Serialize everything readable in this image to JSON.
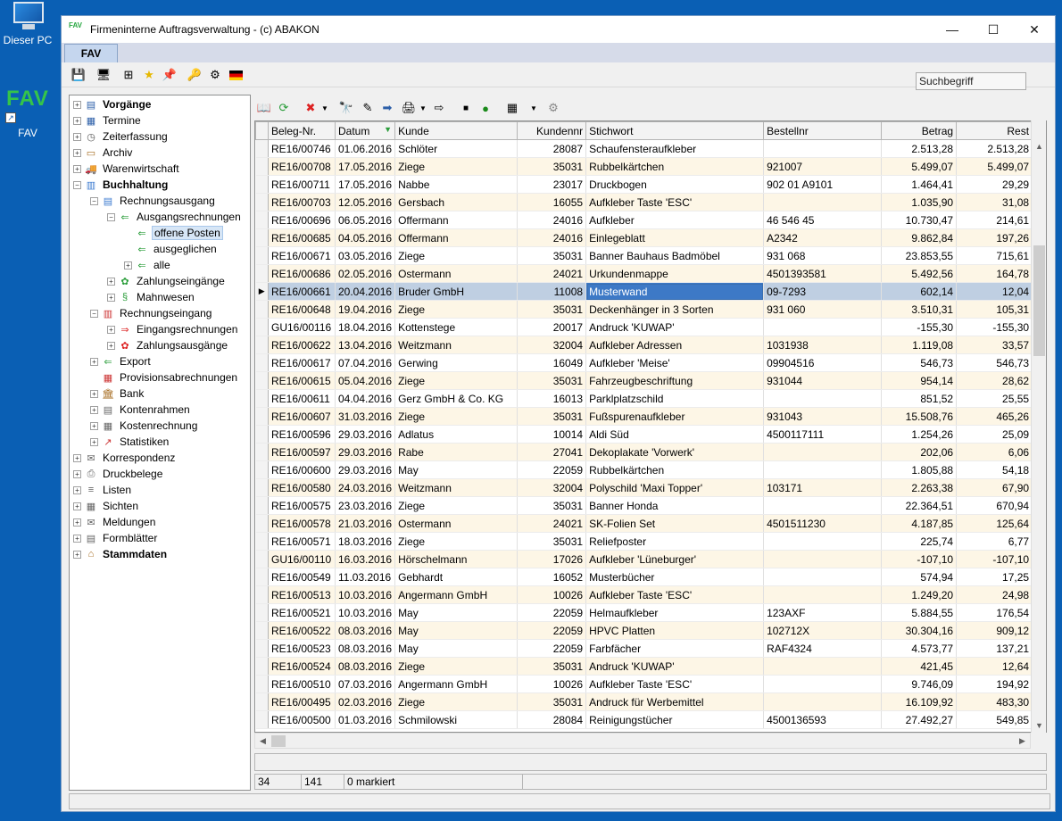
{
  "desktop": {
    "icons": [
      {
        "label": "Dieser PC",
        "icon": "computer-icon"
      },
      {
        "label": "FAV",
        "icon": "fav-app-icon",
        "logo_text": "FAV"
      }
    ]
  },
  "window": {
    "title": "Firmeninterne Auftragsverwaltung - (c) ABAKON",
    "app_logo": "FAV",
    "controls": {
      "minimize": "—",
      "maximize": "☐",
      "close": "✕"
    }
  },
  "tab": {
    "label": "FAV"
  },
  "search": {
    "value": "Suchbegriff"
  },
  "tree": [
    {
      "label": "Vorgänge",
      "level": 0,
      "expander": "+",
      "bold": true,
      "icon": "vorgaenge-icon"
    },
    {
      "label": "Termine",
      "level": 0,
      "expander": "+",
      "icon": "calendar-icon"
    },
    {
      "label": "Zeiterfassung",
      "level": 0,
      "expander": "+",
      "icon": "clock-icon"
    },
    {
      "label": "Archiv",
      "level": 0,
      "expander": "+",
      "icon": "archive-icon"
    },
    {
      "label": "Warenwirtschaft",
      "level": 0,
      "expander": "+",
      "icon": "truck-icon"
    },
    {
      "label": "Buchhaltung",
      "level": 0,
      "expander": "−",
      "bold": true,
      "icon": "bar-chart-icon"
    },
    {
      "label": "Rechnungsausgang",
      "level": 1,
      "expander": "−",
      "icon": "invoice-out-icon"
    },
    {
      "label": "Ausgangsrechnungen",
      "level": 2,
      "expander": "−",
      "icon": "arrow-left-doc-icon"
    },
    {
      "label": "offene Posten",
      "level": 3,
      "expander": "",
      "selected": true,
      "icon": "open-items-icon"
    },
    {
      "label": "ausgeglichen",
      "level": 3,
      "expander": "",
      "icon": "settled-icon"
    },
    {
      "label": "alle",
      "level": 3,
      "expander": "+",
      "icon": "all-items-icon"
    },
    {
      "label": "Zahlungseingänge",
      "level": 2,
      "expander": "+",
      "icon": "payment-in-icon"
    },
    {
      "label": "Mahnwesen",
      "level": 2,
      "expander": "+",
      "icon": "dunning-icon"
    },
    {
      "label": "Rechnungseingang",
      "level": 1,
      "expander": "−",
      "icon": "invoice-in-icon"
    },
    {
      "label": "Eingangsrechnungen",
      "level": 2,
      "expander": "+",
      "icon": "arrow-right-doc-icon"
    },
    {
      "label": "Zahlungsausgänge",
      "level": 2,
      "expander": "+",
      "icon": "payment-out-icon"
    },
    {
      "label": "Export",
      "level": 1,
      "expander": "+",
      "icon": "export-arrow-icon"
    },
    {
      "label": "Provisionsabrechnungen",
      "level": 1,
      "expander": "",
      "icon": "commission-icon"
    },
    {
      "label": "Bank",
      "level": 1,
      "expander": "+",
      "icon": "bank-icon"
    },
    {
      "label": "Kontenrahmen",
      "level": 1,
      "expander": "+",
      "icon": "accounts-icon"
    },
    {
      "label": "Kostenrechnung",
      "level": 1,
      "expander": "+",
      "icon": "calculator-icon"
    },
    {
      "label": "Statistiken",
      "level": 1,
      "expander": "+",
      "icon": "statistics-icon"
    },
    {
      "label": "Korrespondenz",
      "level": 0,
      "expander": "+",
      "icon": "letter-icon"
    },
    {
      "label": "Druckbelege",
      "level": 0,
      "expander": "+",
      "icon": "printer-icon"
    },
    {
      "label": "Listen",
      "level": 0,
      "expander": "+",
      "icon": "list-icon"
    },
    {
      "label": "Sichten",
      "level": 0,
      "expander": "+",
      "icon": "views-icon"
    },
    {
      "label": "Meldungen",
      "level": 0,
      "expander": "+",
      "icon": "envelope-icon"
    },
    {
      "label": "Formblätter",
      "level": 0,
      "expander": "+",
      "icon": "form-icon"
    },
    {
      "label": "Stammdaten",
      "level": 0,
      "expander": "+",
      "bold": true,
      "icon": "house-icon"
    }
  ],
  "grid": {
    "columns": [
      "Beleg-Nr.",
      "Datum",
      "Kunde",
      "Kundennr",
      "Stichwort",
      "Bestellnr",
      "Betrag",
      "Rest"
    ],
    "sort_indicator": "▼",
    "selected_row_marker": "▶",
    "rows": [
      [
        "RE16/00746",
        "01.06.2016",
        "Schlöter",
        "28087",
        "Schaufensteraufkleber",
        "",
        "2.513,28",
        "2.513,28"
      ],
      [
        "RE16/00708",
        "17.05.2016",
        "Ziege",
        "35031",
        "Rubbelkärtchen",
        "921007",
        "5.499,07",
        "5.499,07"
      ],
      [
        "RE16/00711",
        "17.05.2016",
        "Nabbe",
        "23017",
        "Druckbogen",
        "902 01 A9101",
        "1.464,41",
        "29,29"
      ],
      [
        "RE16/00703",
        "12.05.2016",
        "Gersbach",
        "16055",
        "Aufkleber Taste 'ESC'",
        "",
        "1.035,90",
        "31,08"
      ],
      [
        "RE16/00696",
        "06.05.2016",
        "Offermann",
        "24016",
        "Aufkleber",
        "46 546 45",
        "10.730,47",
        "214,61"
      ],
      [
        "RE16/00685",
        "04.05.2016",
        "Offermann",
        "24016",
        "Einlegeblatt",
        "A2342",
        "9.862,84",
        "197,26"
      ],
      [
        "RE16/00671",
        "03.05.2016",
        "Ziege",
        "35031",
        "Banner Bauhaus Badmöbel",
        "931 068",
        "23.853,55",
        "715,61"
      ],
      [
        "RE16/00686",
        "02.05.2016",
        "Ostermann",
        "24021",
        "Urkundenmappe",
        "4501393581",
        "5.492,56",
        "164,78"
      ],
      [
        "RE16/00661",
        "20.04.2016",
        "Bruder GmbH",
        "11008",
        "Musterwand",
        "09-7293",
        "602,14",
        "12,04"
      ],
      [
        "RE16/00648",
        "19.04.2016",
        "Ziege",
        "35031",
        "Deckenhänger in 3 Sorten",
        "931 060",
        "3.510,31",
        "105,31"
      ],
      [
        "GU16/00116",
        "18.04.2016",
        "Kottenstege",
        "20017",
        "Andruck 'KUWAP'",
        "",
        "-155,30",
        "-155,30"
      ],
      [
        "RE16/00622",
        "13.04.2016",
        "Weitzmann",
        "32004",
        "Aufkleber Adressen",
        "1031938",
        "1.119,08",
        "33,57"
      ],
      [
        "RE16/00617",
        "07.04.2016",
        "Gerwing",
        "16049",
        "Aufkleber 'Meise'",
        "09904516",
        "546,73",
        "546,73"
      ],
      [
        "RE16/00615",
        "05.04.2016",
        "Ziege",
        "35031",
        "Fahrzeugbeschriftung",
        "931044",
        "954,14",
        "28,62"
      ],
      [
        "RE16/00611",
        "04.04.2016",
        "Gerz GmbH & Co. KG",
        "16013",
        "Parklplatzschild",
        "",
        "851,52",
        "25,55"
      ],
      [
        "RE16/00607",
        "31.03.2016",
        "Ziege",
        "35031",
        "Fußspurenaufkleber",
        "931043",
        "15.508,76",
        "465,26"
      ],
      [
        "RE16/00596",
        "29.03.2016",
        "Adlatus",
        "10014",
        "Aldi Süd",
        "4500117111",
        "1.254,26",
        "25,09"
      ],
      [
        "RE16/00597",
        "29.03.2016",
        "Rabe",
        "27041",
        "Dekoplakate 'Vorwerk'",
        "",
        "202,06",
        "6,06"
      ],
      [
        "RE16/00600",
        "29.03.2016",
        "May",
        "22059",
        "Rubbelkärtchen",
        "",
        "1.805,88",
        "54,18"
      ],
      [
        "RE16/00580",
        "24.03.2016",
        "Weitzmann",
        "32004",
        "Polyschild 'Maxi Topper'",
        "103171",
        "2.263,38",
        "67,90"
      ],
      [
        "RE16/00575",
        "23.03.2016",
        "Ziege",
        "35031",
        "Banner Honda",
        "",
        "22.364,51",
        "670,94"
      ],
      [
        "RE16/00578",
        "21.03.2016",
        "Ostermann",
        "24021",
        "SK-Folien Set",
        "4501511230",
        "4.187,85",
        "125,64"
      ],
      [
        "RE16/00571",
        "18.03.2016",
        "Ziege",
        "35031",
        "Reliefposter",
        "",
        "225,74",
        "6,77"
      ],
      [
        "GU16/00110",
        "16.03.2016",
        "Hörschelmann",
        "17026",
        "Aufkleber 'Lüneburger'",
        "",
        "-107,10",
        "-107,10"
      ],
      [
        "RE16/00549",
        "11.03.2016",
        "Gebhardt",
        "16052",
        "Musterbücher",
        "",
        "574,94",
        "17,25"
      ],
      [
        "RE16/00513",
        "10.03.2016",
        "Angermann GmbH",
        "10026",
        "Aufkleber Taste 'ESC'",
        "",
        "1.249,20",
        "24,98"
      ],
      [
        "RE16/00521",
        "10.03.2016",
        "May",
        "22059",
        "Helmaufkleber",
        "123AXF",
        "5.884,55",
        "176,54"
      ],
      [
        "RE16/00522",
        "08.03.2016",
        "May",
        "22059",
        "HPVC Platten",
        "102712X",
        "30.304,16",
        "909,12"
      ],
      [
        "RE16/00523",
        "08.03.2016",
        "May",
        "22059",
        "Farbfächer",
        "RAF4324",
        "4.573,77",
        "137,21"
      ],
      [
        "RE16/00524",
        "08.03.2016",
        "Ziege",
        "35031",
        "Andruck 'KUWAP'",
        "",
        "421,45",
        "12,64"
      ],
      [
        "RE16/00510",
        "07.03.2016",
        "Angermann GmbH",
        "10026",
        "Aufkleber Taste 'ESC'",
        "",
        "9.746,09",
        "194,92"
      ],
      [
        "RE16/00495",
        "02.03.2016",
        "Ziege",
        "35031",
        "Andruck für Werbemittel",
        "",
        "16.109,92",
        "483,30"
      ],
      [
        "RE16/00500",
        "01.03.2016",
        "Schmilowski",
        "28084",
        "Reinigungstücher",
        "4500136593",
        "27.492,27",
        "549,85"
      ]
    ],
    "selected_row": 8
  },
  "status": {
    "count": "34",
    "total": "141",
    "marked": "0 markiert"
  },
  "colors": {
    "window_bg": "#f0f0f0",
    "alt_row": "#fdf6e6",
    "selected_row": "#bfcfe2",
    "desktop": "#0a5fb4"
  }
}
